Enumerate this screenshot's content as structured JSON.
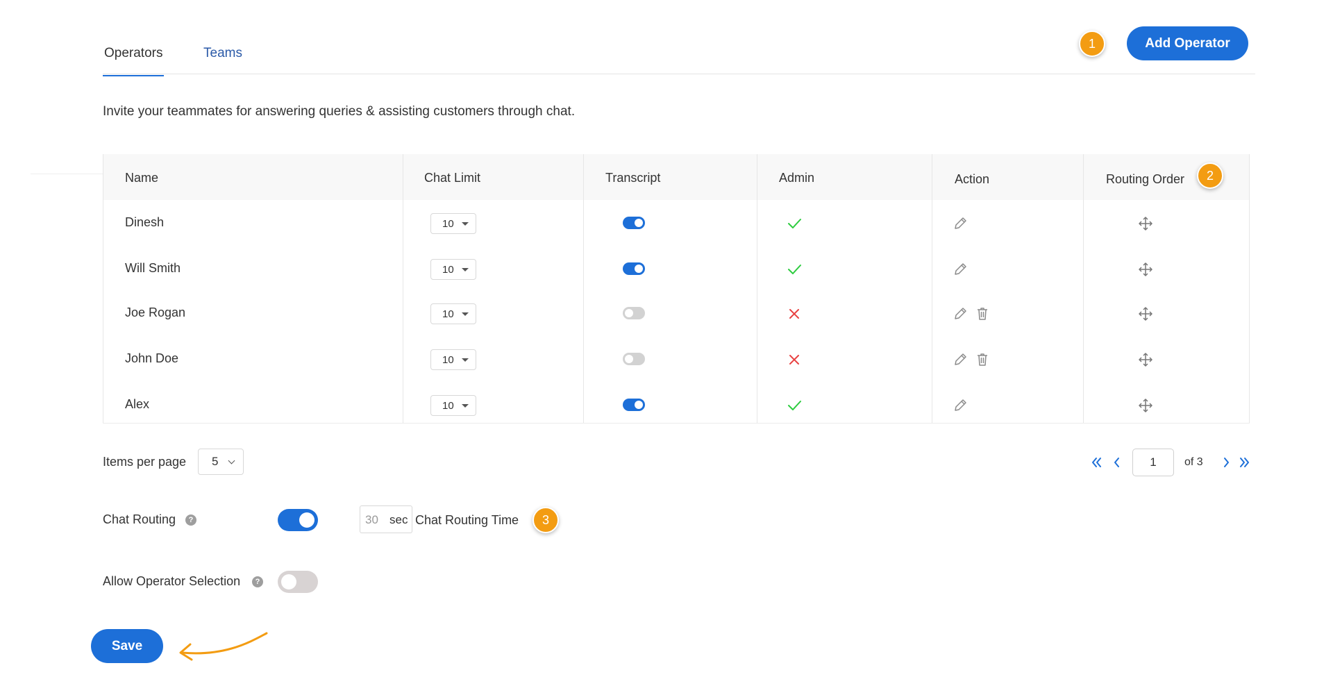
{
  "tabs": [
    {
      "label": "Operators",
      "active": true
    },
    {
      "label": "Teams",
      "active": false
    }
  ],
  "header": {
    "add_button_label": "Add Operator",
    "badge_1": "1"
  },
  "intro_text": "Invite your teammates for answering queries & assisting customers through chat.",
  "table": {
    "columns": [
      "Name",
      "Chat Limit",
      "Transcript",
      "Admin",
      "Action",
      "Routing Order"
    ],
    "badge_2": "2",
    "rows": [
      {
        "name": "Dinesh",
        "chat_limit": "10",
        "transcript": true,
        "admin": true,
        "deletable": false
      },
      {
        "name": "Will Smith",
        "chat_limit": "10",
        "transcript": true,
        "admin": true,
        "deletable": false
      },
      {
        "name": "Joe Rogan",
        "chat_limit": "10",
        "transcript": false,
        "admin": false,
        "deletable": true
      },
      {
        "name": "John Doe",
        "chat_limit": "10",
        "transcript": false,
        "admin": false,
        "deletable": true
      },
      {
        "name": "Alex",
        "chat_limit": "10",
        "transcript": true,
        "admin": true,
        "deletable": false
      }
    ]
  },
  "pagination": {
    "items_per_page_label": "Items per page",
    "items_per_page": "5",
    "current_page": "1",
    "of_label": "of 3"
  },
  "settings": {
    "chat_routing_label": "Chat Routing",
    "chat_routing_enabled": true,
    "routing_time_value": "30",
    "routing_time_unit": "sec",
    "routing_time_label": "Chat Routing Time",
    "badge_3": "3",
    "operator_selection_label": "Allow Operator Selection",
    "operator_selection_enabled": false,
    "help_glyph": "?"
  },
  "save_label": "Save",
  "colors": {
    "primary": "#1d6fd8",
    "badge": "#f39c12",
    "check": "#2ecc40",
    "cross": "#e84141"
  }
}
